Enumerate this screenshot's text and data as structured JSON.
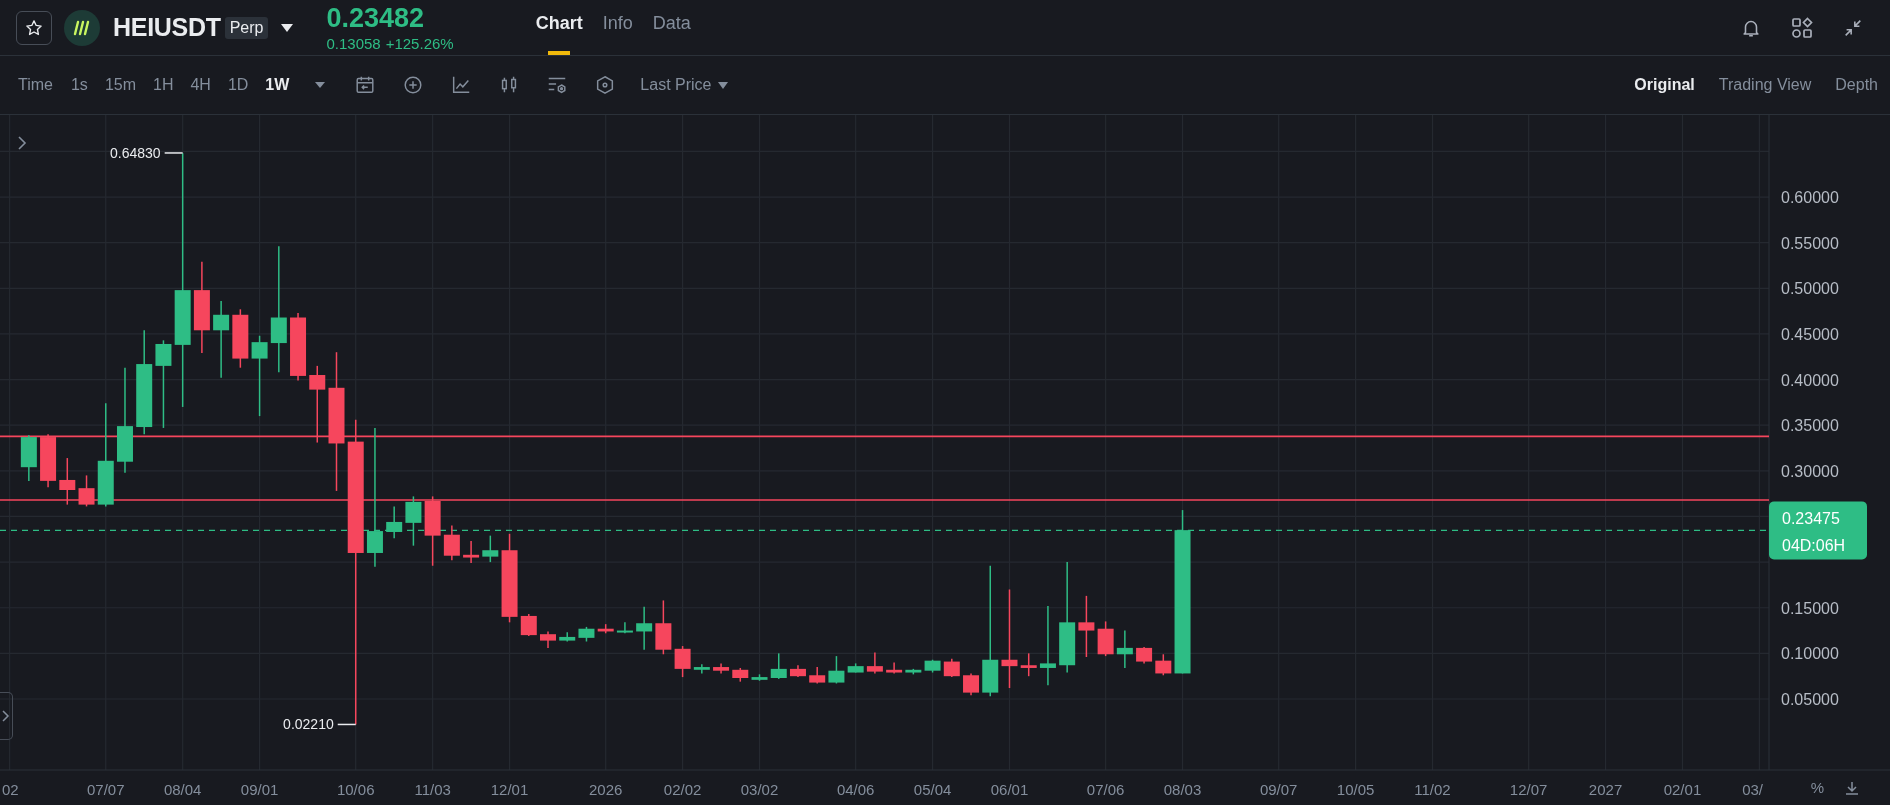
{
  "header": {
    "favorite": false,
    "symbol": "HEIUSDT",
    "contract_badge": "Perp",
    "last_price": "0.23482",
    "change_value": "0.13058",
    "change_percent": "+125.26%",
    "tabs": [
      {
        "label": "Chart",
        "selected": true
      },
      {
        "label": "Info",
        "selected": false
      },
      {
        "label": "Data",
        "selected": false
      }
    ]
  },
  "toolbar": {
    "time_label": "Time",
    "intervals": [
      {
        "label": "1s",
        "selected": false
      },
      {
        "label": "15m",
        "selected": false
      },
      {
        "label": "1H",
        "selected": false
      },
      {
        "label": "4H",
        "selected": false
      },
      {
        "label": "1D",
        "selected": false
      },
      {
        "label": "1W",
        "selected": true
      }
    ],
    "price_type": "Last Price",
    "views": [
      {
        "label": "Original",
        "selected": true
      },
      {
        "label": "Trading View",
        "selected": false
      },
      {
        "label": "Depth",
        "selected": false
      }
    ]
  },
  "chart": {
    "percent_toggle": "%",
    "countdown": "04D:06H",
    "chart_data": {
      "type": "candlestick",
      "grid": true,
      "categories": [
        "02",
        null,
        null,
        null,
        null,
        "07/07",
        null,
        null,
        null,
        "08/04",
        null,
        null,
        null,
        "09/01",
        null,
        null,
        null,
        null,
        "10/06",
        null,
        null,
        null,
        "11/03",
        null,
        null,
        null,
        "12/01",
        null,
        null,
        null,
        null,
        "2026",
        null,
        null,
        null,
        "02/02",
        null,
        null,
        null,
        "03/02",
        null,
        null,
        null,
        null,
        "04/06",
        null,
        null,
        null,
        "05/04",
        null,
        null,
        null,
        "06/01",
        null,
        null,
        null,
        null,
        "07/06",
        null,
        null,
        null,
        "08/03",
        null,
        null,
        null,
        null,
        "09/07",
        null,
        null,
        null,
        "10/05",
        null,
        null,
        null,
        "11/02",
        null,
        null,
        null,
        null,
        "12/07",
        null,
        null,
        null,
        "2027",
        null,
        null,
        null,
        "02/01",
        null,
        null,
        null,
        "03/"
      ],
      "ohlc": [
        null,
        [
          0.304,
          0.339,
          0.289,
          0.337
        ],
        [
          0.337,
          0.34,
          0.282,
          0.289
        ],
        [
          0.29,
          0.314,
          0.263,
          0.279
        ],
        [
          0.281,
          0.295,
          0.261,
          0.263
        ],
        [
          0.263,
          0.374,
          0.261,
          0.311
        ],
        [
          0.31,
          0.413,
          0.298,
          0.349
        ],
        [
          0.348,
          0.454,
          0.34,
          0.417
        ],
        [
          0.415,
          0.443,
          0.347,
          0.439
        ],
        [
          0.438,
          0.648,
          0.37,
          0.498
        ],
        [
          0.498,
          0.529,
          0.429,
          0.454
        ],
        [
          0.454,
          0.486,
          0.402,
          0.471
        ],
        [
          0.471,
          0.477,
          0.413,
          0.423
        ],
        [
          0.423,
          0.448,
          0.36,
          0.441
        ],
        [
          0.44,
          0.546,
          0.408,
          0.468
        ],
        [
          0.468,
          0.473,
          0.399,
          0.404
        ],
        [
          0.405,
          0.415,
          0.331,
          0.389
        ],
        [
          0.391,
          0.43,
          0.278,
          0.33
        ],
        [
          0.332,
          0.356,
          0.022,
          0.21
        ],
        [
          0.21,
          0.347,
          0.195,
          0.234
        ],
        [
          0.233,
          0.261,
          0.226,
          0.244
        ],
        [
          0.243,
          0.272,
          0.218,
          0.266
        ],
        [
          0.267,
          0.272,
          0.196,
          0.229
        ],
        [
          0.23,
          0.24,
          0.202,
          0.207
        ],
        [
          0.208,
          0.223,
          0.199,
          0.205
        ],
        [
          0.206,
          0.229,
          0.2,
          0.213
        ],
        [
          0.213,
          0.231,
          0.134,
          0.14
        ],
        [
          0.141,
          0.143,
          0.119,
          0.12
        ],
        [
          0.121,
          0.124,
          0.106,
          0.114
        ],
        [
          0.114,
          0.123,
          0.113,
          0.118
        ],
        [
          0.117,
          0.129,
          0.113,
          0.127
        ],
        [
          0.127,
          0.132,
          0.122,
          0.124
        ],
        [
          0.123,
          0.134,
          0.122,
          0.125
        ],
        [
          0.124,
          0.151,
          0.104,
          0.133
        ],
        [
          0.133,
          0.158,
          0.099,
          0.104
        ],
        [
          0.105,
          0.108,
          0.074,
          0.083
        ],
        [
          0.082,
          0.088,
          0.078,
          0.085
        ],
        [
          0.085,
          0.089,
          0.078,
          0.081
        ],
        [
          0.082,
          0.084,
          0.069,
          0.073
        ],
        [
          0.071,
          0.077,
          0.07,
          0.074
        ],
        [
          0.073,
          0.1,
          0.072,
          0.083
        ],
        [
          0.083,
          0.087,
          0.074,
          0.075
        ],
        [
          0.076,
          0.085,
          0.067,
          0.068
        ],
        [
          0.068,
          0.097,
          0.067,
          0.081
        ],
        [
          0.079,
          0.089,
          0.079,
          0.086
        ],
        [
          0.086,
          0.101,
          0.078,
          0.08
        ],
        [
          0.082,
          0.09,
          0.078,
          0.079
        ],
        [
          0.079,
          0.083,
          0.077,
          0.082
        ],
        [
          0.081,
          0.093,
          0.079,
          0.092
        ],
        [
          0.091,
          0.094,
          0.074,
          0.075
        ],
        [
          0.076,
          0.078,
          0.054,
          0.057
        ],
        [
          0.057,
          0.196,
          0.053,
          0.093
        ],
        [
          0.093,
          0.17,
          0.062,
          0.086
        ],
        [
          0.087,
          0.1,
          0.075,
          0.084
        ],
        [
          0.084,
          0.152,
          0.065,
          0.089
        ],
        [
          0.087,
          0.2,
          0.079,
          0.134
        ],
        [
          0.134,
          0.163,
          0.096,
          0.125
        ],
        [
          0.127,
          0.135,
          0.097,
          0.099
        ],
        [
          0.099,
          0.125,
          0.084,
          0.106
        ],
        [
          0.106,
          0.107,
          0.089,
          0.091
        ],
        [
          0.092,
          0.099,
          0.076,
          0.078
        ],
        [
          0.078,
          0.257,
          0.078,
          0.235
        ],
        null,
        null,
        null,
        null,
        null,
        null,
        null,
        null,
        null,
        null,
        null,
        null,
        null,
        null,
        null,
        null,
        null,
        null,
        null,
        null,
        null,
        null,
        null,
        null,
        null,
        null,
        null,
        null,
        null,
        null
      ],
      "ylim": [
        -0.0278,
        0.6899
      ],
      "yticks": [
        {
          "value": 0.05,
          "label": "0.05000"
        },
        {
          "value": 0.1,
          "label": "0.10000"
        },
        {
          "value": 0.15,
          "label": "0.15000"
        },
        {
          "value": 0.3,
          "label": "0.30000"
        },
        {
          "value": 0.35,
          "label": "0.35000"
        },
        {
          "value": 0.4,
          "label": "0.40000"
        },
        {
          "value": 0.45,
          "label": "0.45000"
        },
        {
          "value": 0.5,
          "label": "0.50000"
        },
        {
          "value": 0.55,
          "label": "0.55000"
        },
        {
          "value": 0.6,
          "label": "0.60000"
        }
      ],
      "annotations": [
        {
          "text": "0.64830",
          "x": "08/04",
          "y": 0.6483
        },
        {
          "text": "0.02210",
          "x": "10/06",
          "y": 0.0221
        }
      ],
      "ref_lines": [
        {
          "axis": "y",
          "value": 0.3378,
          "color": "#f6465d"
        },
        {
          "axis": "y",
          "value": 0.268,
          "color": "#f6465d"
        },
        {
          "axis": "y",
          "value": 0.23475,
          "color": "#2ebd85",
          "label": "0.23475"
        }
      ]
    }
  }
}
